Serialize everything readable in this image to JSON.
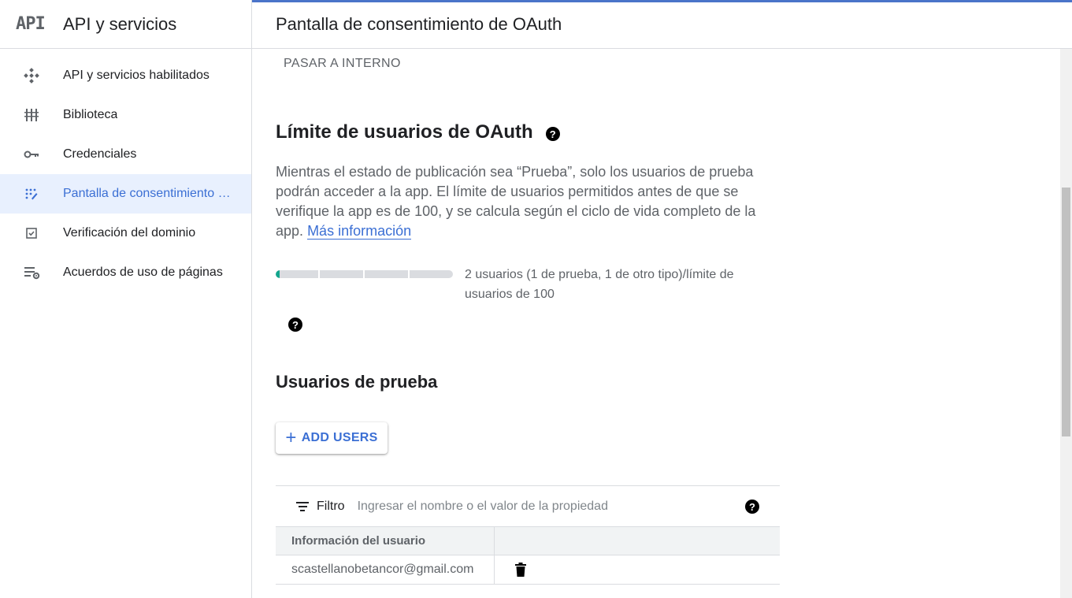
{
  "sidebar": {
    "logo": "API",
    "title": "API y servicios",
    "items": [
      {
        "label": "API y servicios habilitados",
        "icon": "api-diamond-icon",
        "active": false
      },
      {
        "label": "Biblioteca",
        "icon": "library-icon",
        "active": false
      },
      {
        "label": "Credenciales",
        "icon": "key-icon",
        "active": false
      },
      {
        "label": "Pantalla de consentimiento de OAuth",
        "icon": "consent-dots-icon",
        "active": true
      },
      {
        "label": "Verificación del dominio",
        "icon": "checkbox-icon",
        "active": false
      },
      {
        "label": "Acuerdos de uso de páginas",
        "icon": "list-settings-icon",
        "active": false
      }
    ]
  },
  "header": {
    "title": "Pantalla de consentimiento de OAuth"
  },
  "content": {
    "pasar_label": "PASAR A INTERNO",
    "limit_heading": "Límite de usuarios de OAuth",
    "description": "Mientras el estado de publicación sea “Prueba”, solo los usuarios de prueba podrán acceder a la app. El límite de usuarios permitidos antes de que se verifique la app es de 100, y se calcula según el ciclo de vida completo de la app.",
    "more_info_link": "Más información",
    "usage_text": "2 usuarios (1 de prueba, 1 de otro tipo)/límite de usuarios de 100",
    "usage_fraction": 0.02,
    "test_users_heading": "Usuarios de prueba",
    "add_users_label": "ADD USERS"
  },
  "table": {
    "filter_label": "Filtro",
    "filter_placeholder": "Ingresar el nombre o el valor de la propiedad",
    "column_header": "Información del usuario",
    "rows": [
      {
        "email": "scastellanobetancor@gmail.com"
      }
    ]
  },
  "colors": {
    "accent": "#3b6fd4",
    "active_bg": "#e8f0fe",
    "progress_fill": "#12a68d"
  }
}
